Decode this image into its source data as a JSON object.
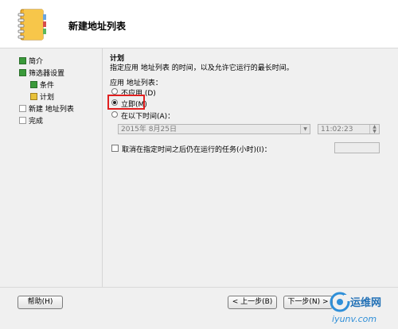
{
  "header": {
    "title": "新建地址列表"
  },
  "sidebar": {
    "items": [
      {
        "label": "简介",
        "state": "done"
      },
      {
        "label": "筛选器设置",
        "state": "done"
      },
      {
        "label": "条件",
        "state": "done"
      },
      {
        "label": "计划",
        "state": "current"
      },
      {
        "label": "新建 地址列表",
        "state": "pending"
      },
      {
        "label": "完成",
        "state": "pending"
      }
    ]
  },
  "main": {
    "section_title": "计划",
    "description": "指定应用 地址列表 的时间，以及允许它运行的最长时间。",
    "apply_label": "应用 地址列表：",
    "options": [
      {
        "label": "不应用 (D)",
        "selected": false
      },
      {
        "label": "立即(M)",
        "selected": true
      },
      {
        "label": "在以下时间(A)：",
        "selected": false
      }
    ],
    "date_value": "2015年 8月25日",
    "time_value": "11:02:23",
    "cancel_label": "取消在指定时间之后仍在运行的任务(小时)(I)：",
    "cancel_checked": false
  },
  "footer": {
    "help_button": "帮助(H)",
    "back_button": "< 上一步(B)",
    "next_button": "下一步(N) >"
  },
  "watermark": {
    "brand": "运维网",
    "url": "iyunv.com"
  },
  "colors": {
    "highlight": "#e02020",
    "done": "#3a9a3a",
    "current": "#e8c23a"
  }
}
